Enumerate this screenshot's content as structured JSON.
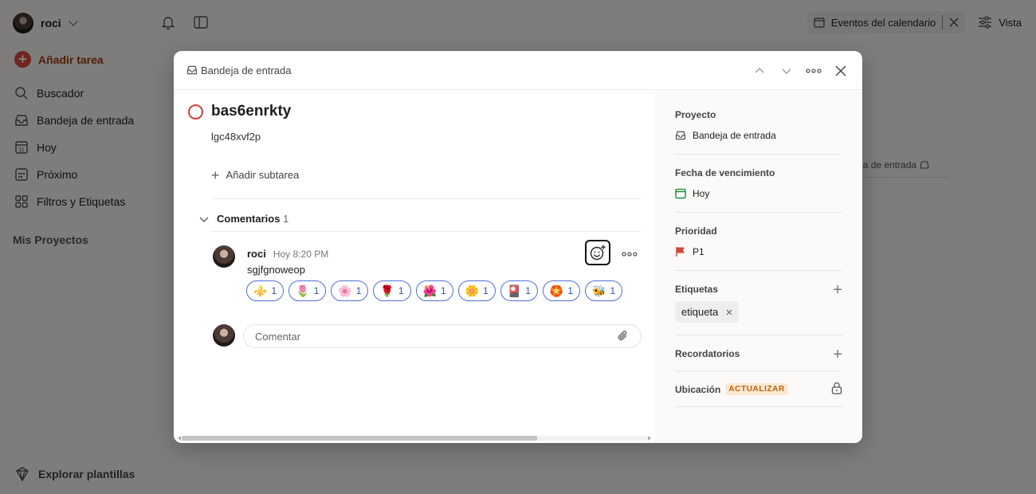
{
  "sidebar": {
    "user_name": "roci",
    "add_task": "Añadir tarea",
    "items": [
      {
        "label": "Buscador",
        "icon": "search-icon"
      },
      {
        "label": "Bandeja de entrada",
        "icon": "inbox-icon"
      },
      {
        "label": "Hoy",
        "icon": "calendar-today-icon"
      },
      {
        "label": "Próximo",
        "icon": "calendar-grid-icon"
      },
      {
        "label": "Filtros y Etiquetas",
        "icon": "grid-icon"
      }
    ],
    "projects_heading": "Mis Proyectos",
    "templates": "Explorar plantillas"
  },
  "topbar": {
    "calendar_events": "Eventos del calendario",
    "view": "Vista"
  },
  "background": {
    "row_text": "ndeja de entrada"
  },
  "modal": {
    "breadcrumb": "Bandeja de entrada",
    "task": {
      "title": "bas6enrkty",
      "description": "lgc48xvf2p",
      "add_subtask": "Añadir subtarea"
    },
    "comments": {
      "heading": "Comentarios",
      "count": "1",
      "items": [
        {
          "author": "roci",
          "time": "Hoy 8:20 PM",
          "text": "sgjfgnoweop",
          "reactions": [
            {
              "emoji": "⚜️",
              "count": "1"
            },
            {
              "emoji": "🌷",
              "count": "1"
            },
            {
              "emoji": "🌸",
              "count": "1"
            },
            {
              "emoji": "🌹",
              "count": "1"
            },
            {
              "emoji": "🌺",
              "count": "1"
            },
            {
              "emoji": "🌼",
              "count": "1"
            },
            {
              "emoji": "🎴",
              "count": "1"
            },
            {
              "emoji": "🏵️",
              "count": "1"
            },
            {
              "emoji": "🐝",
              "count": "1"
            }
          ]
        }
      ],
      "input_placeholder": "Comentar"
    },
    "side": {
      "project_label": "Proyecto",
      "project_value": "Bandeja de entrada",
      "due_label": "Fecha de vencimiento",
      "due_value": "Hoy",
      "priority_label": "Prioridad",
      "priority_value": "P1",
      "labels_label": "Etiquetas",
      "label_chip": "etiqueta",
      "reminders_label": "Recordatorios",
      "location_label": "Ubicación",
      "location_badge": "ACTUALIZAR"
    }
  },
  "colors": {
    "accent": "#dc4c3e",
    "priority_p1": "#d1453b",
    "reaction_border": "#4f70d6",
    "update_badge_bg": "#fde8d2"
  }
}
